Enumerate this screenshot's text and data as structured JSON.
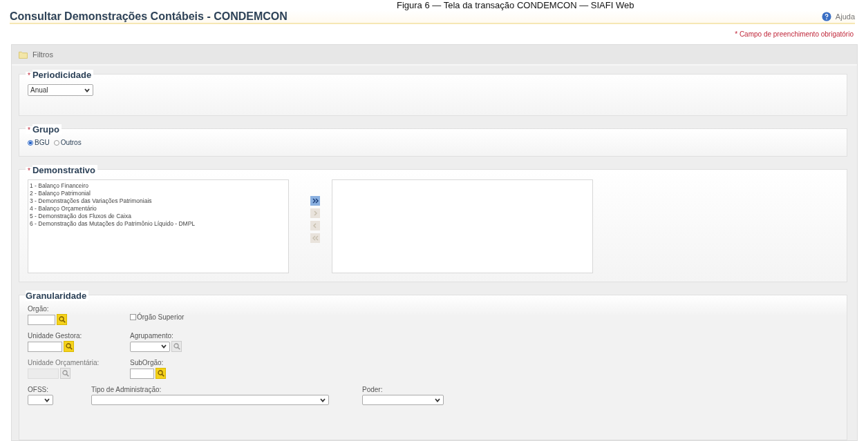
{
  "caption": "Figura 6 — Tela da transação CONDEMCON — SIAFI Web",
  "page": {
    "title": "Consultar Demonstrações Contábeis - CONDEMCON",
    "help": "Ajuda",
    "required_note": "* Campo de preenchimento obrigatório"
  },
  "panel": {
    "title": "Filtros"
  },
  "periodicidade": {
    "mark": "*",
    "legend": "Periodicidade",
    "value": "Anual"
  },
  "grupo": {
    "mark": "*",
    "legend": "Grupo",
    "options": [
      {
        "label": "BGU",
        "selected": true
      },
      {
        "label": "Outros",
        "selected": false
      }
    ]
  },
  "demonstrativo": {
    "mark": "*",
    "legend": "Demonstrativo",
    "available": [
      {
        "label": "1 - Balanço Financeiro",
        "selected": false
      },
      {
        "label": "2 - Balanço Patrimonial",
        "selected": false
      },
      {
        "label": "3 - Demonstrações das Variações Patrimoniais",
        "selected": false
      },
      {
        "label": "4 - Balanço Orçamentário",
        "selected": false
      },
      {
        "label": "5 - Demonstração dos Fluxos de Caixa",
        "selected": false
      },
      {
        "label": "6 - Demonstração das Mutações do Patrimônio Líquido - DMPL",
        "selected": false
      }
    ],
    "transfer_buttons": [
      {
        "kind": "all_right",
        "disabled": false
      },
      {
        "kind": "right",
        "disabled": true
      },
      {
        "kind": "left",
        "disabled": true
      },
      {
        "kind": "all_left",
        "disabled": true
      }
    ]
  },
  "granularidade": {
    "legend": "Granularidade",
    "rows": [
      [
        {
          "kind": "lookup",
          "label": "Orgão:",
          "disabled": false
        },
        {
          "kind": "checkbox",
          "label": "Órgão Superior",
          "checked": false
        }
      ],
      [
        {
          "kind": "lookup",
          "label": "Unidade Gestora:",
          "disabled": false
        },
        {
          "kind": "select_lookup",
          "label": "Agrupamento:",
          "disabled": true
        }
      ],
      [
        {
          "kind": "lookup",
          "label": "Unidade Orçamentária:",
          "disabled": true
        },
        {
          "kind": "lookup",
          "label": "SubOrgão:",
          "disabled": false
        }
      ],
      [
        {
          "kind": "select",
          "label": "OFSS:"
        },
        {
          "kind": "select",
          "label": "Tipo de Administração:"
        },
        {
          "kind": "select",
          "label": "Poder:"
        }
      ]
    ]
  }
}
